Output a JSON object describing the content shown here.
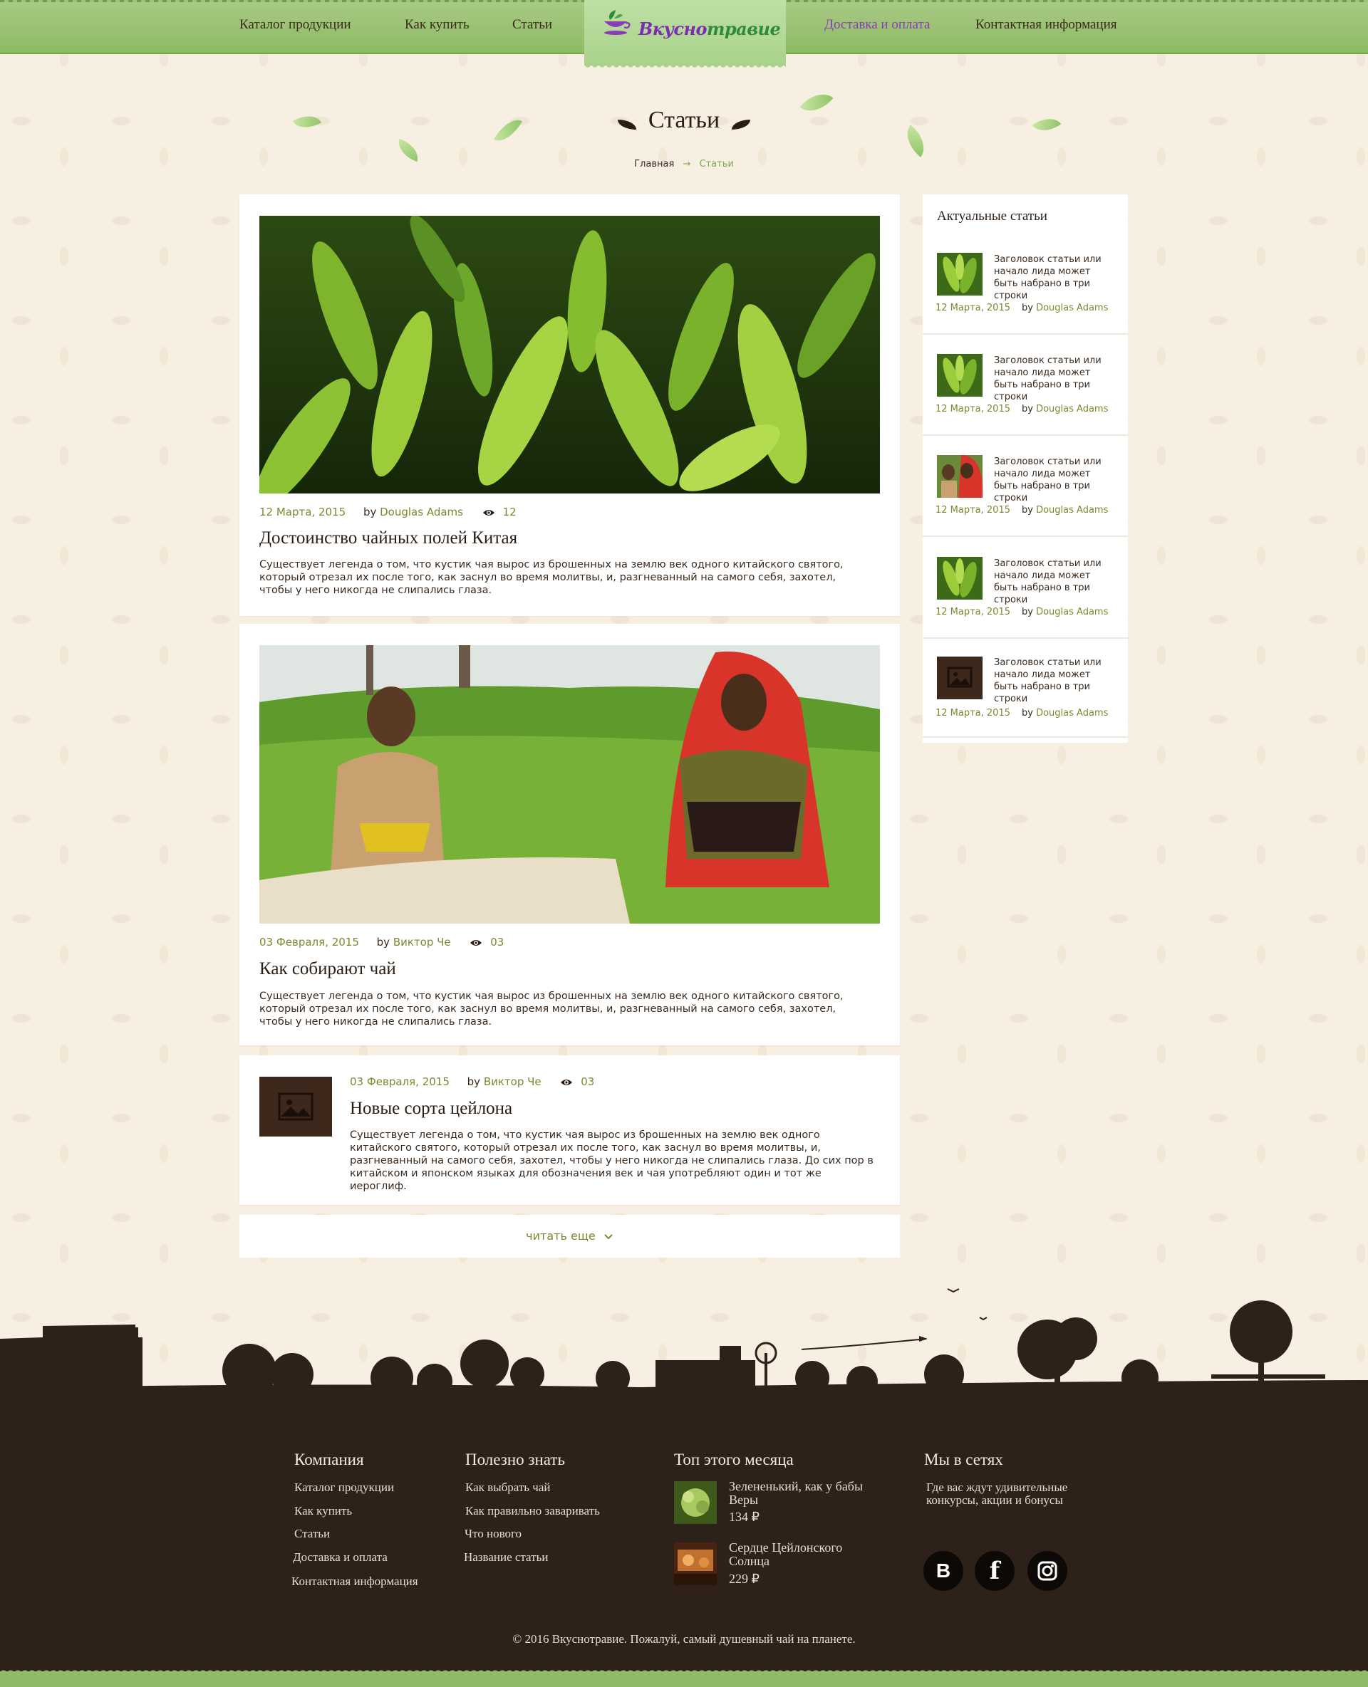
{
  "nav": {
    "items": [
      "Каталог продукции",
      "Как купить",
      "Статьи",
      "Доставка и оплата",
      "Контактная информация"
    ],
    "logo": {
      "part1": "Вкусно",
      "part2": "травие"
    }
  },
  "header": {
    "title": "Статьи",
    "breadcrumb": {
      "home": "Главная",
      "arrow": "→",
      "current": "Статьи"
    }
  },
  "articles": [
    {
      "date": "12 Марта, 2015",
      "by": "by",
      "author": "Douglas Adams",
      "views": "12",
      "title": "Достоинство чайных полей Китая",
      "text": "Существует легенда о том, что кустик чая вырос из брошенных на землю век одного китайского святого, который отрезал их после того, как заснул во время молитвы, и, разгневанный на самого себя, захотел, чтобы у него никогда не слипались глаза."
    },
    {
      "date": "03 Февраля, 2015",
      "by": "by",
      "author": "Виктор Че",
      "views": "03",
      "title": "Как собирают чай",
      "text": "Существует легенда о том, что кустик чая вырос из брошенных на землю век одного китайского святого, который отрезал их после того, как заснул во время молитвы, и, разгневанный на самого себя, захотел, чтобы у него никогда не слипались глаза."
    },
    {
      "date": "03 Февраля, 2015",
      "by": "by",
      "author": "Виктор Че",
      "views": "03",
      "title": "Новые сорта цейлона",
      "text": "Существует легенда о том, что кустик чая вырос из брошенных на землю век одного китайского святого, который отрезал их после того, как заснул во время молитвы, и, разгневанный на самого себя, захотел, чтобы у него никогда не слипались глаза. До сих пор в китайском и японском языках для обозначения век и чая употребляют один и тот же иероглиф."
    }
  ],
  "read_more": "читать еще",
  "sidebar": {
    "title": "Актуальные статьи",
    "items": [
      {
        "text": "Заголовок статьи или начало лида может быть набрано в три строки",
        "date": "12 Марта, 2015",
        "by": "by",
        "author": "Douglas Adams",
        "thumb": "leaves"
      },
      {
        "text": "Заголовок статьи или начало лида может быть набрано в три строки",
        "date": "12 Марта, 2015",
        "by": "by",
        "author": "Douglas Adams",
        "thumb": "leaves"
      },
      {
        "text": "Заголовок статьи или начало лида может быть набрано в три строки",
        "date": "12 Марта, 2015",
        "by": "by",
        "author": "Douglas Adams",
        "thumb": "people"
      },
      {
        "text": "Заголовок статьи или начало лида может быть набрано в три строки",
        "date": "12 Марта, 2015",
        "by": "by",
        "author": "Douglas Adams",
        "thumb": "leaves"
      },
      {
        "text": "Заголовок статьи или начало лида может быть набрано в три строки",
        "date": "12 Марта, 2015",
        "by": "by",
        "author": "Douglas Adams",
        "thumb": "placeholder"
      }
    ]
  },
  "footer": {
    "company": {
      "title": "Компания",
      "links": [
        "Каталог продукции",
        "Как купить",
        "Статьи",
        "Доставка и оплата",
        "Контактная информация"
      ]
    },
    "useful": {
      "title": "Полезно знать",
      "links": [
        "Как выбрать чай",
        "Как правильно заваривать",
        "Что нового",
        "Название статьи"
      ]
    },
    "top": {
      "title": "Топ этого месяца",
      "products": [
        {
          "name": "Зелененький, как у бабы Веры",
          "price": "134 ₽"
        },
        {
          "name": "Сердце Цейлонского Солнца",
          "price": "229 ₽"
        }
      ]
    },
    "social": {
      "title": "Мы в сетях",
      "text": "Где вас ждут удивительные конкурсы, акции и бонусы",
      "networks": [
        {
          "name": "vk-icon",
          "glyph": "B"
        },
        {
          "name": "facebook-icon",
          "glyph": "f"
        },
        {
          "name": "instagram-icon",
          "glyph": ""
        }
      ]
    },
    "copyright": "© 2016 Вкуснотравие. Пожалуй, самый душевный чай на планете."
  },
  "colors": {
    "accent_green": "#8dba63",
    "link_olive": "#7a8a2e",
    "active_purple": "#8a3db5",
    "footer_bg": "#2e211a",
    "page_bg": "#f7efe2"
  }
}
